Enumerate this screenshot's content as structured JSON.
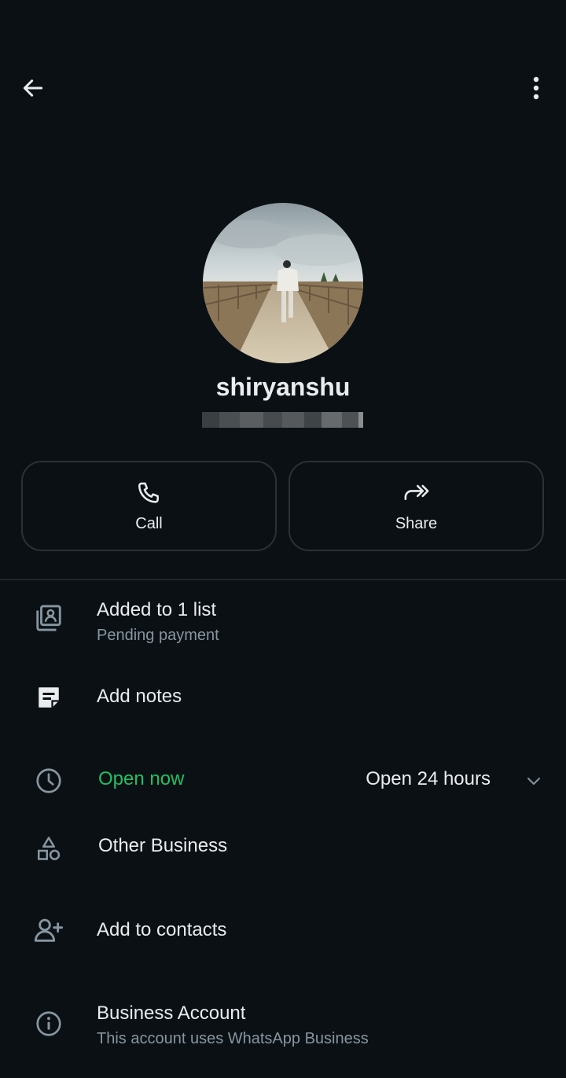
{
  "header": {
    "back_icon": "arrow-left-icon",
    "menu_icon": "more-vertical-icon"
  },
  "profile": {
    "name": "shiryanshu",
    "avatar_icon": "profile-photo"
  },
  "actions": {
    "call_label": "Call",
    "call_icon": "phone-icon",
    "share_label": "Share",
    "share_icon": "share-forward-icon"
  },
  "rows": {
    "list": {
      "title": "Added to 1 list",
      "subtitle": "Pending payment",
      "icon": "contact-list-icon"
    },
    "notes": {
      "title": "Add notes",
      "icon": "notes-icon"
    },
    "hours": {
      "status": "Open now",
      "hours": "Open 24 hours",
      "icon": "clock-icon",
      "chevron_icon": "chevron-down-icon"
    },
    "category": {
      "title": "Other Business",
      "icon": "shapes-icon"
    },
    "contacts": {
      "title": "Add to contacts",
      "icon": "person-add-icon"
    },
    "business": {
      "title": "Business Account",
      "subtitle": "This account uses WhatsApp Business",
      "icon": "info-icon"
    }
  },
  "colors": {
    "background": "#0b1014",
    "text_primary": "#e9edef",
    "text_secondary": "#8696a0",
    "accent_green": "#21c063",
    "border": "#2a3236"
  }
}
